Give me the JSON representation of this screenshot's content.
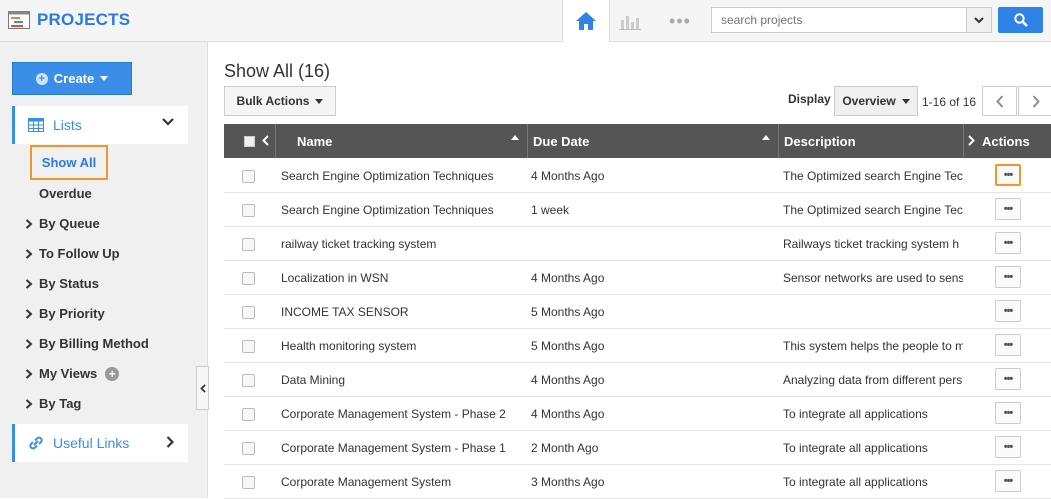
{
  "app": {
    "title": "PROJECTS"
  },
  "search": {
    "placeholder": "search projects"
  },
  "sidebar": {
    "create_label": "Create",
    "lists_label": "Lists",
    "show_all": "Show All",
    "overdue": "Overdue",
    "groups": [
      "By Queue",
      "To Follow Up",
      "By Status",
      "By Priority",
      "By Billing Method",
      "My Views",
      "By Tag"
    ],
    "useful_links": "Useful Links"
  },
  "main": {
    "heading": "Show All (16)",
    "bulk_actions": "Bulk Actions",
    "display_label": "Display",
    "display_value": "Overview",
    "paging": "1-16 of 16"
  },
  "table": {
    "headers": {
      "name": "Name",
      "due": "Due Date",
      "desc": "Description",
      "actions": "Actions"
    },
    "rows": [
      {
        "name": "Search Engine Optimization Techniques",
        "due": "4 Months Ago",
        "desc": "The Optimized search Engine Tec"
      },
      {
        "name": "Search Engine Optimization Techniques",
        "due": "1 week",
        "desc": "The Optimized search Engine Tec"
      },
      {
        "name": "railway ticket tracking system",
        "due": "",
        "desc": "Railways ticket  tracking system h"
      },
      {
        "name": "Localization in WSN",
        "due": "4 Months Ago",
        "desc": "Sensor networks are used to sens"
      },
      {
        "name": "INCOME TAX SENSOR",
        "due": "5 Months Ago",
        "desc": ""
      },
      {
        "name": "Health monitoring system",
        "due": "5 Months Ago",
        "desc": "This system helps the people to m"
      },
      {
        "name": "Data Mining",
        "due": "4 Months Ago",
        "desc": "Analyzing data from different pers"
      },
      {
        "name": "Corporate Management System - Phase 2",
        "due": "4 Months Ago",
        "desc": "To integrate all applications"
      },
      {
        "name": "Corporate Management System - Phase 1",
        "due": "2 Month Ago",
        "desc": "To integrate all applications"
      },
      {
        "name": "Corporate Management System",
        "due": "3 Months Ago",
        "desc": "To integrate all applications"
      }
    ],
    "action_glyph": "•••"
  },
  "colors": {
    "accent": "#2a7ae2",
    "highlight": "#f0962a",
    "header_bg": "#555555"
  }
}
